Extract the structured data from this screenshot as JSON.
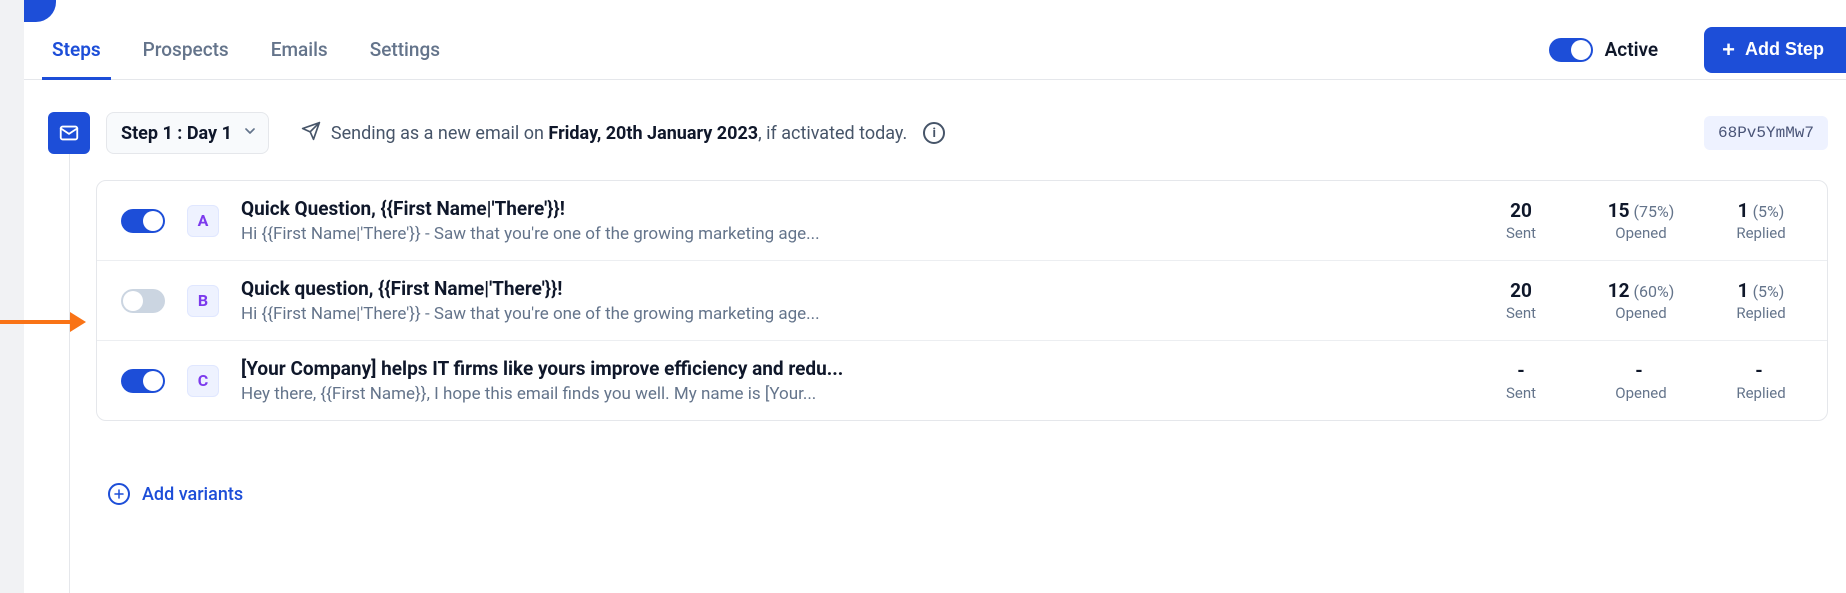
{
  "tabs": {
    "items": [
      "Steps",
      "Prospects",
      "Emails",
      "Settings"
    ],
    "active_index": 0
  },
  "topbar": {
    "active_label": "Active",
    "active_on": true,
    "add_step_label": "Add Step"
  },
  "step": {
    "pill_label": "Step 1 : Day 1",
    "sending_prefix": "Sending as a new email on ",
    "sending_date": "Friday, 20th January 2023",
    "sending_suffix": ", if activated today.",
    "hash": "68Pv5YmMw7"
  },
  "stats_labels": {
    "sent": "Sent",
    "opened": "Opened",
    "replied": "Replied"
  },
  "variants": [
    {
      "toggle_on": true,
      "badge": "A",
      "title": "Quick Question, {{First Name|'There'}}!",
      "preview": "Hi {{First Name|'There'}}  - Saw that you're one of the growing marketing age...",
      "sent": "20",
      "opened_n": "15",
      "opened_pct": "(75%)",
      "replied_n": "1",
      "replied_pct": "(5%)"
    },
    {
      "toggle_on": false,
      "badge": "B",
      "title": "Quick question, {{First Name|'There'}}!",
      "preview": "Hi {{First Name|'There'}} - Saw that you're one of the growing marketing age...",
      "sent": "20",
      "opened_n": "12",
      "opened_pct": "(60%)",
      "replied_n": "1",
      "replied_pct": "(5%)"
    },
    {
      "toggle_on": true,
      "badge": "C",
      "title": "[Your Company] helps IT firms like yours improve efficiency and redu...",
      "preview": "Hey there, {{First Name}},   I hope this email finds you well. My name is [Your...",
      "sent": "-",
      "opened_n": "-",
      "opened_pct": "",
      "replied_n": "-",
      "replied_pct": ""
    }
  ],
  "add_variants_label": "Add variants"
}
